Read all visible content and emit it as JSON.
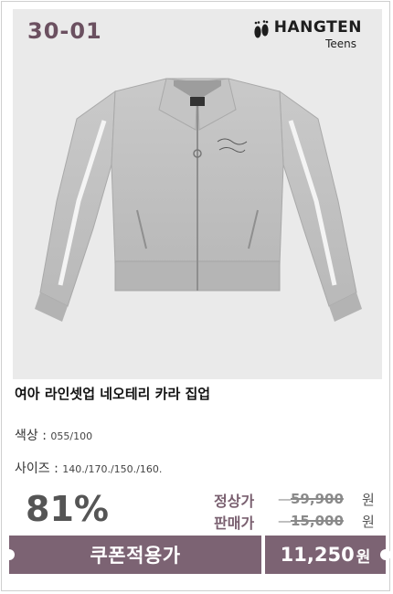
{
  "product": {
    "code": "30-01",
    "brand": "HANGTEN",
    "brand_sub": "Teens",
    "title": "여아 라인셋업 네오테리 카라 집업",
    "color_label": "색상 : ",
    "color_value": "055/100",
    "size_label": "사이즈 : ",
    "size_value": "140./170./150./160."
  },
  "pricing": {
    "discount": "81%",
    "regular_label": "정상가",
    "regular_price": "59,900",
    "sale_label": "판매가",
    "sale_price": "15,000",
    "currency": "원"
  },
  "coupon": {
    "label": "쿠폰적용가",
    "price": "11,250",
    "currency": "원"
  },
  "colors": {
    "accent": "#7c6373",
    "code_text": "#6b5060",
    "photo_bg": "#eaeaea"
  }
}
